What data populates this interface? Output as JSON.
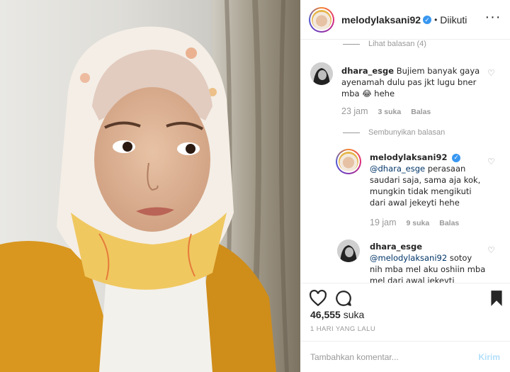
{
  "header": {
    "username": "melodylaksani92",
    "separator": "•",
    "follow_state": "Diikuti",
    "verified_mark": "✓",
    "more_icon": "more-options-icon"
  },
  "comments": {
    "view_replies_label": "Lihat balasan (4)",
    "hide_replies_label": "Sembunyikan balasan",
    "items": [
      {
        "user": "dhara_esge",
        "text": "Bujiem banyak gaya ayenamah dulu pas jkt lugu bner mba 😂 hehe",
        "age": "23 jam",
        "likes": "3 suka",
        "reply": "Balas"
      },
      {
        "user": "melodylaksani92",
        "mention": "@dhara_esge",
        "text": "perasaan saudari saja, sama aja kok, mungkin tidak mengikuti dari awal jekeyti hehe",
        "age": "19 jam",
        "likes": "9 suka",
        "reply": "Balas"
      },
      {
        "user": "dhara_esge",
        "mention": "@melodylaksani92",
        "text": "sotoy nih mba mel aku oshiin mba mel dari awal jekeyti"
      }
    ]
  },
  "actions": {
    "like_icon": "heart-icon",
    "comment_icon": "comment-icon",
    "save_icon": "bookmark-icon"
  },
  "likes": {
    "count": "46,555",
    "word": "suka"
  },
  "timestamp": "1 HARI YANG LALU",
  "add_comment": {
    "placeholder": "Tambahkan komentar...",
    "post_label": "Kirim"
  },
  "colors": {
    "link": "#003569",
    "muted": "#999999",
    "verified": "#3897f0",
    "post_disabled": "#b2dffc"
  }
}
